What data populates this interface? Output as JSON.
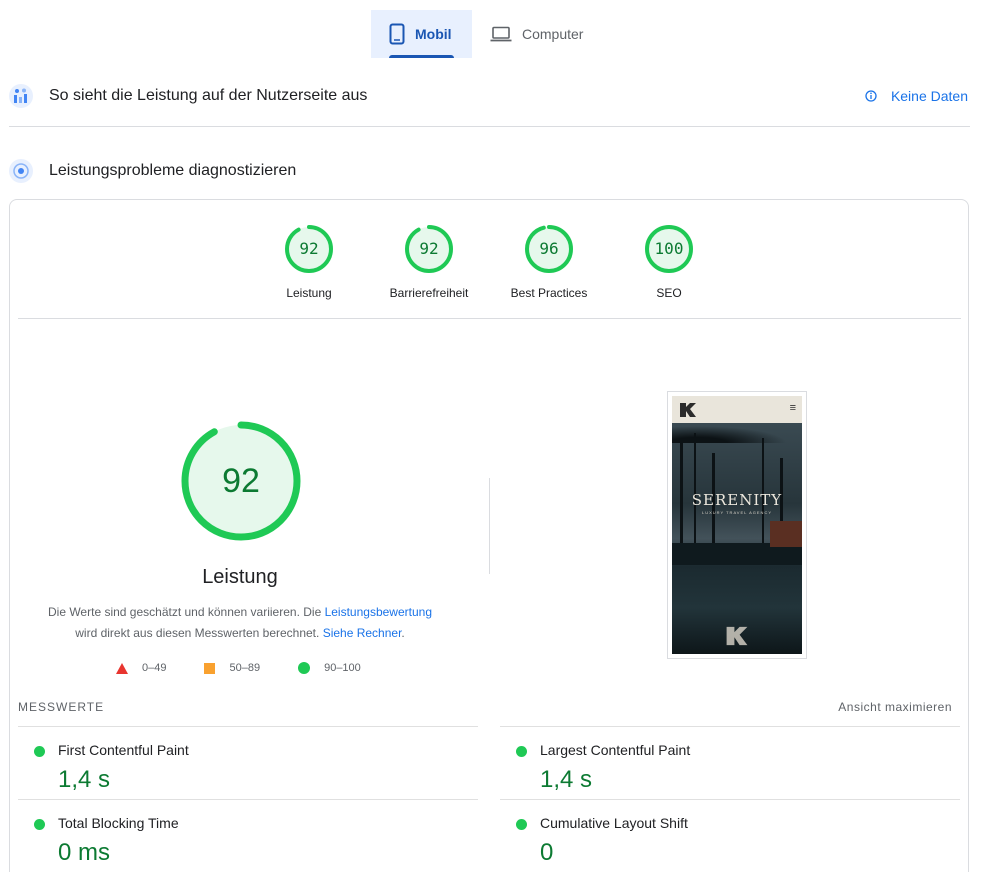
{
  "tabs": [
    {
      "label": "Mobil",
      "icon": "smartphone-icon",
      "active": true
    },
    {
      "label": "Computer",
      "icon": "laptop-icon",
      "active": false
    }
  ],
  "field_data": {
    "title": "So sieht die Leistung auf der Nutzerseite aus",
    "status_label": "Keine Daten",
    "status_icon": "info-icon"
  },
  "diagnose": {
    "title": "Leistungsprobleme diagnostizieren"
  },
  "scores": [
    {
      "label": "Leistung",
      "value": "92"
    },
    {
      "label": "Barrierefreiheit",
      "value": "92"
    },
    {
      "label": "Best Practices",
      "value": "96"
    },
    {
      "label": "SEO",
      "value": "100"
    }
  ],
  "main_score": {
    "value": "92",
    "title": "Leistung",
    "desc_part1": "Die Werte sind geschätzt und können variieren. Die ",
    "desc_link1": "Leistungsbewertung",
    "desc_part2": "wird direkt aus diesen Messwerten berechnet. ",
    "desc_link2": "Siehe Rechner",
    "desc_part3": "."
  },
  "legend": [
    {
      "label": "0–49",
      "color": "#e8352f"
    },
    {
      "label": "50–89",
      "color": "#f9a12f"
    },
    {
      "label": "90–100",
      "color": "#1fc955"
    }
  ],
  "screenshot": {
    "brand": "SERENITY",
    "tagline": "LUXURY TRAVEL AGENCY"
  },
  "metrics_section": {
    "heading": "MESSWERTE",
    "expand_label": "Ansicht maximieren"
  },
  "metrics": [
    {
      "name": "First Contentful Paint",
      "value": "1,4 s"
    },
    {
      "name": "Largest Contentful Paint",
      "value": "1,4 s"
    },
    {
      "name": "Total Blocking Time",
      "value": "0 ms"
    },
    {
      "name": "Cumulative Layout Shift",
      "value": "0"
    }
  ],
  "colors": {
    "good": "#1fc955",
    "good_text": "#0c7a32",
    "accent": "#1a73e8"
  }
}
